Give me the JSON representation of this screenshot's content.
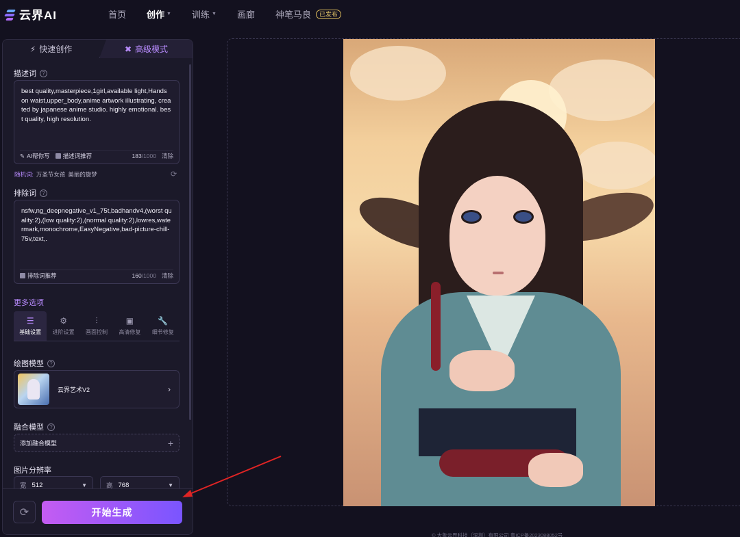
{
  "brand": {
    "name": "云界AI"
  },
  "nav": {
    "items": [
      {
        "label": "首页"
      },
      {
        "label": "创作"
      },
      {
        "label": "训练"
      },
      {
        "label": "画廊"
      },
      {
        "label": "神笔马良"
      }
    ],
    "badge": "已发布"
  },
  "mode_tabs": {
    "quick": "快速创作",
    "advanced": "高级模式"
  },
  "prompt": {
    "label": "描述词",
    "text": "best quality,masterpiece,1girl,available light,Hands on waist,upper_body,anime artwork illustrating, created by japanese anime studio. highly emotional. best quality, high resolution.",
    "ai_write": "AI帮你写",
    "recommend": "描述词推荐",
    "count": "183",
    "limit": "/1000",
    "clear": "清除"
  },
  "random": {
    "label": "随机词:",
    "words": [
      "万圣节女孩",
      "美丽的旋梦"
    ]
  },
  "negative": {
    "label": "排除词",
    "text": "nsfw,ng_deepnegative_v1_75t,badhandv4,(worst quality:2),(low quality:2),(normal quality:2),lowres,watermark,monochrome,EasyNegative,bad-picture-chill-75v,text,.",
    "recommend": "排除词推荐",
    "count": "160",
    "limit": "/1000",
    "clear": "清除"
  },
  "more_options": "更多选项",
  "subtabs": [
    {
      "label": "基础设置",
      "icon": "sliders-icon"
    },
    {
      "label": "进阶设置",
      "icon": "gear-icon"
    },
    {
      "label": "画面控制",
      "icon": "tune-icon"
    },
    {
      "label": "高清修复",
      "icon": "hd-icon"
    },
    {
      "label": "细节修复",
      "icon": "wrench-icon"
    }
  ],
  "model": {
    "label": "绘图模型",
    "name": "云界艺术V2"
  },
  "fusion": {
    "label": "融合模型",
    "add": "添加融合模型"
  },
  "resolution": {
    "label": "图片分辨率",
    "width_label": "宽",
    "width": "512",
    "height_label": "高",
    "height": "768"
  },
  "generate": "开始生成",
  "footer": "© 大象云界科技（深圳）有限公司 粤ICP备2023088052号"
}
